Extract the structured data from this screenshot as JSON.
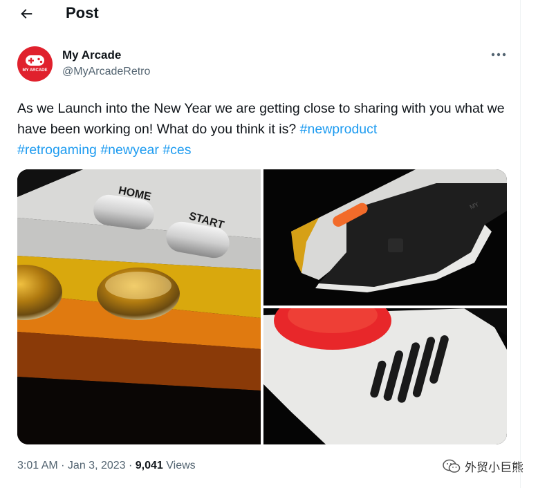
{
  "header": {
    "title": "Post"
  },
  "author": {
    "name": "My Arcade",
    "handle": "@MyArcadeRetro",
    "avatar_text": "MY ARCADE"
  },
  "tweet": {
    "text_main": "As we Launch into the New Year we are getting close to sharing with you what we have been working on! What do you think it is? ",
    "hashtags": [
      "#newproduct",
      "#retrogaming",
      "#newyear",
      "#ces"
    ]
  },
  "media": {
    "image_a_labels": [
      "HOME",
      "START"
    ]
  },
  "meta": {
    "time": "3:01 AM",
    "date": "Jan 3, 2023",
    "separator": " · ",
    "views_count": "9,041",
    "views_label": "Views"
  },
  "watermark": {
    "text": "外贸小巨熊"
  },
  "colors": {
    "accent": "#1d9bf0",
    "secondary_text": "#536471",
    "avatar_bg": "#e0212d",
    "orange_button": "#f26b2a",
    "red_button": "#e8272a"
  }
}
